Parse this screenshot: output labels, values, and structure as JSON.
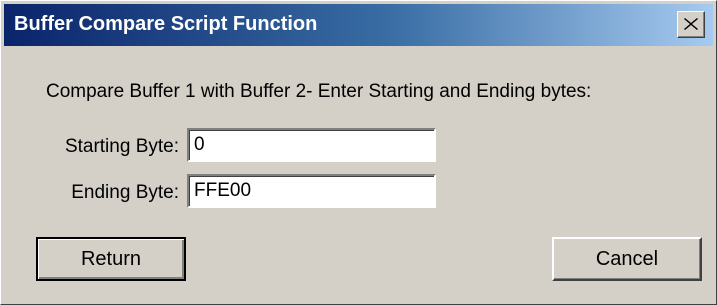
{
  "window": {
    "title": "Buffer Compare Script Function",
    "close_icon": "close-x-icon",
    "colors": {
      "titlebar_start": "#0a246a",
      "titlebar_end": "#a6caf0",
      "face": "#d4d0c8"
    }
  },
  "form": {
    "instruction": "Compare Buffer 1 with Buffer 2- Enter Starting and Ending bytes:",
    "start": {
      "label": "Starting Byte:",
      "value": "0"
    },
    "end": {
      "label": "Ending Byte:",
      "value": "FFE00"
    }
  },
  "buttons": {
    "return_label": "Return",
    "cancel_label": "Cancel"
  }
}
